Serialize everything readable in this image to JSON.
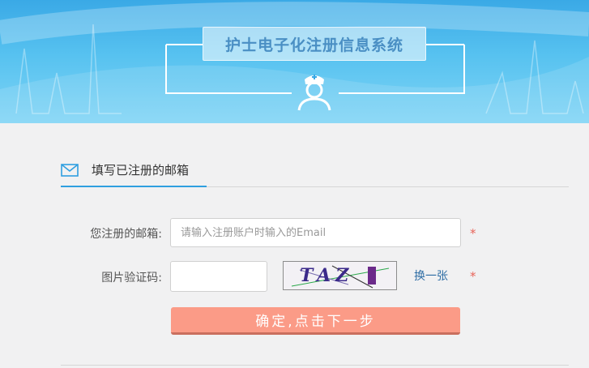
{
  "header": {
    "title": "护士电子化注册信息系统",
    "icon": "nurse-icon"
  },
  "section": {
    "title": "填写已注册的邮箱",
    "icon": "mail-icon"
  },
  "form": {
    "email_label": "您注册的邮箱:",
    "email_placeholder": "请输入注册账户时输入的Email",
    "email_value": "",
    "captcha_label": "图片验证码:",
    "captcha_value": "",
    "captcha_image_text": "TAZ",
    "refresh_label": "换一张",
    "required_mark": "*",
    "submit_label": "确定,点击下一步"
  },
  "colors": {
    "accent_blue": "#2f9fe0",
    "submit_bg": "#fb9b87",
    "required_red": "#e8645a",
    "link_blue": "#2e6da4"
  }
}
